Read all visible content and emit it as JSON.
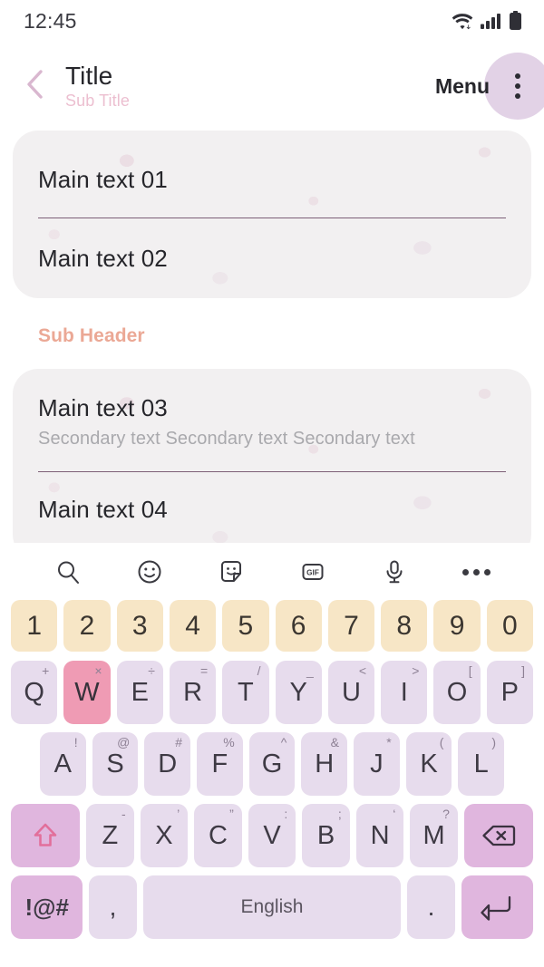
{
  "status_bar": {
    "time": "12:45",
    "icons": [
      "wifi-icon",
      "cellular-signal-icon",
      "battery-icon"
    ]
  },
  "app_bar": {
    "back_icon": "chevron-left-icon",
    "title": "Title",
    "subtitle": "Sub Title",
    "menu_label": "Menu",
    "overflow_icon": "more-vertical-icon"
  },
  "content": {
    "card_a": {
      "rows": [
        {
          "main": "Main text 01"
        },
        {
          "main": "Main text 02"
        }
      ]
    },
    "sub_header": "Sub Header",
    "card_b": {
      "rows": [
        {
          "main": "Main text 03",
          "secondary": "Secondary text Secondary text Secondary text"
        },
        {
          "main": "Main text 04"
        }
      ]
    }
  },
  "keyboard": {
    "toolbar": [
      {
        "name": "search-icon"
      },
      {
        "name": "emoji-icon"
      },
      {
        "name": "sticker-icon"
      },
      {
        "name": "gif-icon",
        "label": "GIF"
      },
      {
        "name": "microphone-icon"
      },
      {
        "name": "more-horizontal-icon"
      }
    ],
    "number_row": [
      "1",
      "2",
      "3",
      "4",
      "5",
      "6",
      "7",
      "8",
      "9",
      "0"
    ],
    "row1": [
      {
        "key": "Q",
        "sup": "+"
      },
      {
        "key": "W",
        "sup": "×",
        "state": "pressed"
      },
      {
        "key": "E",
        "sup": "÷"
      },
      {
        "key": "R",
        "sup": "="
      },
      {
        "key": "T",
        "sup": "/"
      },
      {
        "key": "Y",
        "sup": "_"
      },
      {
        "key": "U",
        "sup": "<"
      },
      {
        "key": "I",
        "sup": ">"
      },
      {
        "key": "O",
        "sup": "["
      },
      {
        "key": "P",
        "sup": "]"
      }
    ],
    "row2": [
      {
        "key": "A",
        "sup": "!"
      },
      {
        "key": "S",
        "sup": "@"
      },
      {
        "key": "D",
        "sup": "#"
      },
      {
        "key": "F",
        "sup": "%"
      },
      {
        "key": "G",
        "sup": "^"
      },
      {
        "key": "H",
        "sup": "&"
      },
      {
        "key": "J",
        "sup": "*"
      },
      {
        "key": "K",
        "sup": "("
      },
      {
        "key": "L",
        "sup": ")"
      }
    ],
    "row3": {
      "shift_icon": "shift-arrow-icon",
      "letters": [
        {
          "key": "Z",
          "sup": "-"
        },
        {
          "key": "X",
          "sup": "’"
        },
        {
          "key": "C",
          "sup": "”"
        },
        {
          "key": "V",
          "sup": ":"
        },
        {
          "key": "B",
          "sup": ";"
        },
        {
          "key": "N",
          "sup": "‘"
        },
        {
          "key": "M",
          "sup": "?"
        }
      ],
      "backspace_icon": "backspace-icon"
    },
    "row4": {
      "symbols_label": "!@#",
      "comma": ",",
      "space_label": "English",
      "period": ".",
      "enter_icon": "enter-return-icon"
    }
  },
  "colors": {
    "key_default": "#e7dced",
    "key_number": "#f7e6c6",
    "key_pressed": "#ef9bb4",
    "key_accent": "#e0b6de",
    "card_bg": "#f2f0f1",
    "divider": "#7d5f77",
    "subtitle": "#ecbfd0",
    "sub_header": "#eba895",
    "menu_fab": "#e2d2e6"
  }
}
